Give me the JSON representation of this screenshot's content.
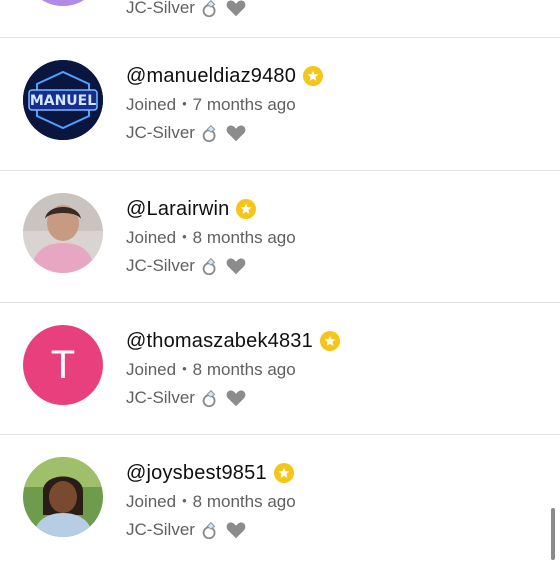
{
  "rows": [
    {
      "handle": "",
      "joined": "",
      "tier": "JC-Silver",
      "avatar": "purple-avatar"
    },
    {
      "handle": "@manueldiaz9480",
      "joined_label": "Joined",
      "joined_ago": "7 months ago",
      "tier": "JC-Silver",
      "avatar": "neon-manuel-avatar",
      "avatar_text": "MANUEL"
    },
    {
      "handle": "@Larairwin",
      "joined_label": "Joined",
      "joined_ago": "8 months ago",
      "tier": "JC-Silver",
      "avatar": "photo-avatar"
    },
    {
      "handle": "@thomaszabek4831",
      "joined_label": "Joined",
      "joined_ago": "8 months ago",
      "tier": "JC-Silver",
      "avatar": "letter-avatar",
      "avatar_letter": "T"
    },
    {
      "handle": "@joysbest9851",
      "joined_label": "Joined",
      "joined_ago": "8 months ago",
      "tier": "JC-Silver",
      "avatar": "photo-avatar"
    }
  ],
  "separator": "•",
  "colors": {
    "verified": "#f5c518",
    "letter_avatar": "#e8407c",
    "neon": "#3a5cff"
  }
}
